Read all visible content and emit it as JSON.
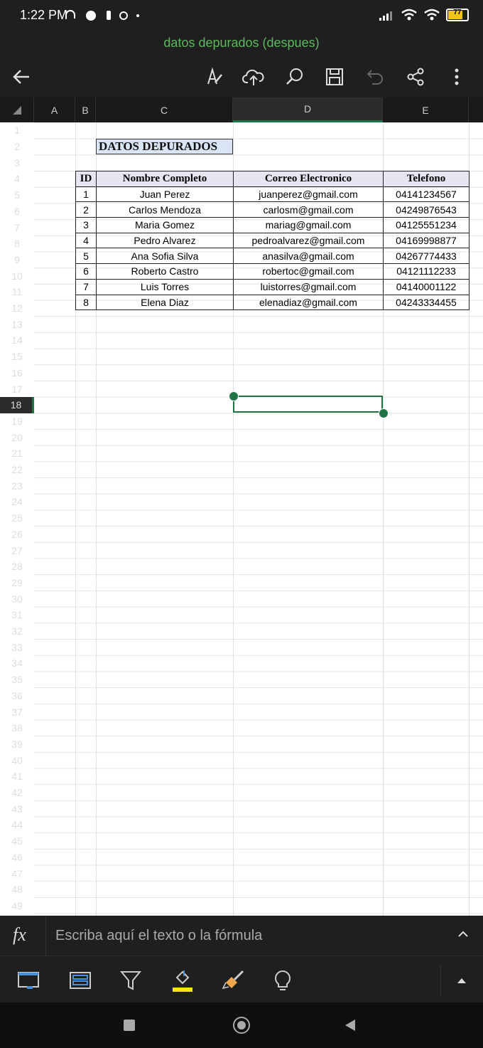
{
  "status": {
    "time": "1:22 PM",
    "battery": "77"
  },
  "doc_title": "datos depurados (despues)",
  "columns": [
    "A",
    "B",
    "C",
    "D",
    "E"
  ],
  "rows_visible": 49,
  "selected_cell": "D18",
  "sheet": {
    "title": "DATOS DEPURADOS",
    "headers": [
      "ID",
      "Nombre Completo",
      "Correo Electronico",
      "Telefono"
    ],
    "records": [
      [
        "1",
        "Juan Perez",
        "juanperez@gmail.com",
        "04141234567"
      ],
      [
        "2",
        "Carlos Mendoza",
        "carlosm@gmail.com",
        "04249876543"
      ],
      [
        "3",
        "Maria Gomez",
        "mariag@gmail.com",
        "04125551234"
      ],
      [
        "4",
        "Pedro Alvarez",
        "pedroalvarez@gmail.com",
        "04169998877"
      ],
      [
        "5",
        "Ana Sofia Silva",
        "anasilva@gmail.com",
        "04267774433"
      ],
      [
        "6",
        "Roberto Castro",
        "robertoc@gmail.com",
        "04121112233"
      ],
      [
        "7",
        "Luis Torres",
        "luistorres@gmail.com",
        "04140001122"
      ],
      [
        "8",
        "Elena Diaz",
        "elenadiaz@gmail.com",
        "04243334455"
      ]
    ]
  },
  "formula_bar": {
    "fx": "fx",
    "placeholder": "Escriba aquí el texto o la fórmula"
  },
  "colors": {
    "accent": "#217346",
    "title_green": "#5cb85c",
    "title_fill": "#d9e4f5",
    "header_fill": "#e7e5f2"
  }
}
